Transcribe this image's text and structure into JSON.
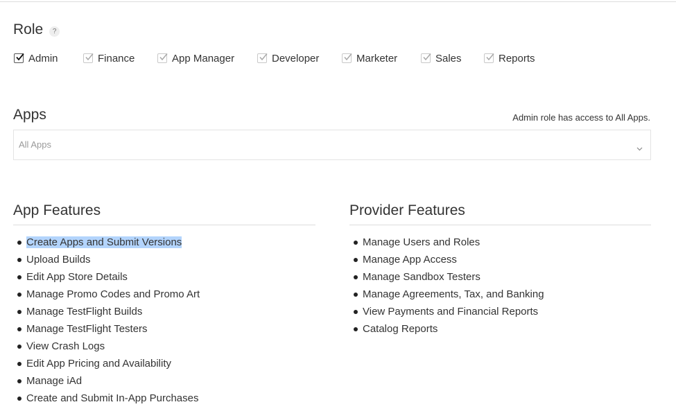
{
  "role": {
    "title": "Role",
    "help": "?",
    "options": [
      {
        "label": "Admin",
        "checked": true
      },
      {
        "label": "Finance",
        "checked": true
      },
      {
        "label": "App Manager",
        "checked": true
      },
      {
        "label": "Developer",
        "checked": true
      },
      {
        "label": "Marketer",
        "checked": true
      },
      {
        "label": "Sales",
        "checked": true
      },
      {
        "label": "Reports",
        "checked": true
      }
    ]
  },
  "apps": {
    "title": "Apps",
    "note": "Admin role has access to All Apps.",
    "select_value": "All Apps",
    "icon": "chevron-down-icon"
  },
  "app_features": {
    "title": "App Features",
    "items": [
      "Create Apps and Submit Versions",
      "Upload Builds",
      "Edit App Store Details",
      "Manage Promo Codes and Promo Art",
      "Manage TestFlight Builds",
      "Manage TestFlight Testers",
      "View Crash Logs",
      "Edit App Pricing and Availability",
      "Manage iAd",
      "Create and Submit In-App Purchases"
    ]
  },
  "provider_features": {
    "title": "Provider Features",
    "items": [
      "Manage Users and Roles",
      "Manage App Access",
      "Manage Sandbox Testers",
      "Manage Agreements, Tax, and Banking",
      "View Payments and Financial Reports",
      "Catalog Reports"
    ]
  },
  "colors": {
    "text": "#333333",
    "selection_highlight": "#b3d4fc",
    "divider": "#dddddd",
    "checkmark_active": "#111111",
    "checkmark_disabled": "#a8a8a8"
  }
}
